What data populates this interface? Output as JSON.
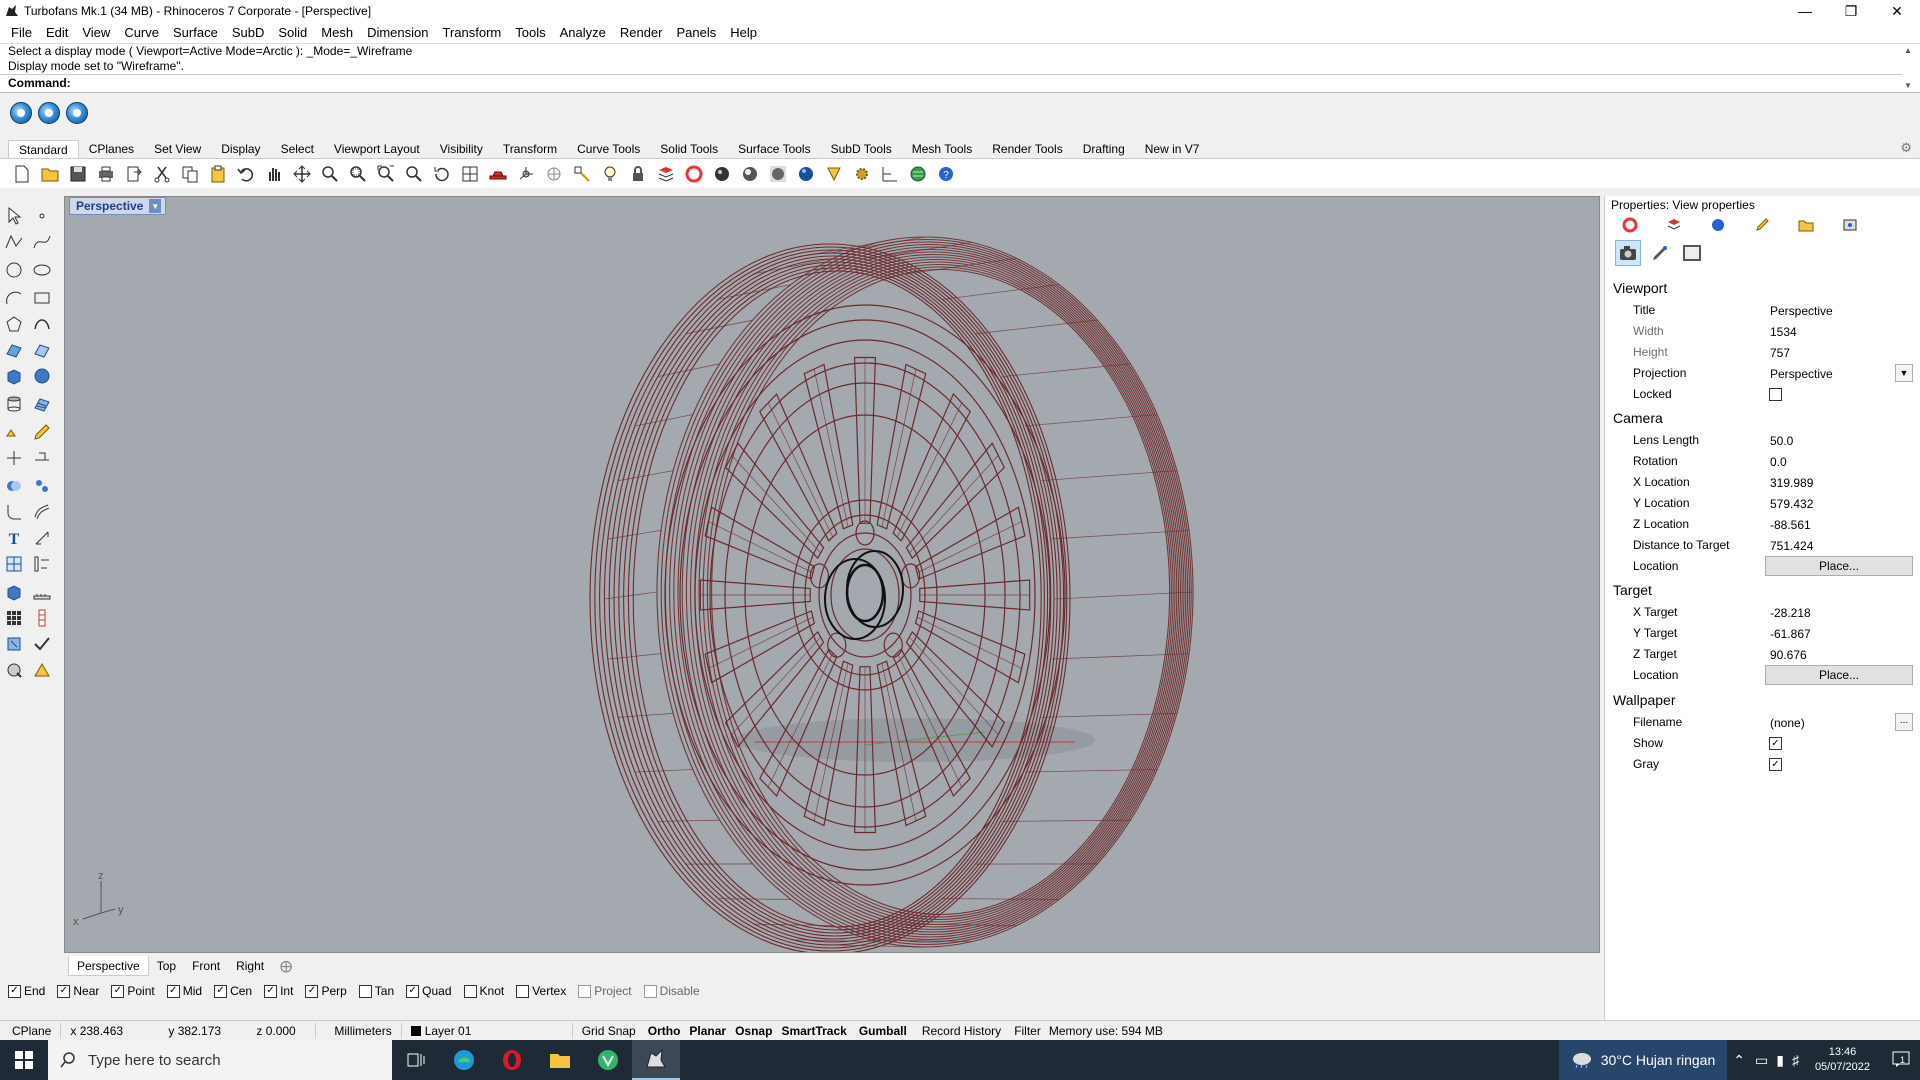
{
  "window": {
    "title": "Turbofans Mk.1 (34 MB) - Rhinoceros 7 Corporate - [Perspective]",
    "controls": [
      "minimize",
      "restore",
      "close"
    ]
  },
  "menu": [
    "File",
    "Edit",
    "View",
    "Curve",
    "Surface",
    "SubD",
    "Solid",
    "Mesh",
    "Dimension",
    "Transform",
    "Tools",
    "Analyze",
    "Render",
    "Panels",
    "Help"
  ],
  "command": {
    "history": [
      "Select a display mode ( Viewport=Active  Mode=Arctic ): _Mode=_Wireframe",
      "Display mode set to \"Wireframe\"."
    ],
    "prompt": "Command:"
  },
  "toolbar_tabs": [
    "Standard",
    "CPlanes",
    "Set View",
    "Display",
    "Select",
    "Viewport Layout",
    "Visibility",
    "Transform",
    "Curve Tools",
    "Solid Tools",
    "Surface Tools",
    "SubD Tools",
    "Mesh Tools",
    "Render Tools",
    "Drafting",
    "New in V7"
  ],
  "active_toolbar_tab": "Standard",
  "viewport": {
    "title": "Perspective",
    "display_mode": "Wireframe",
    "axes": {
      "x": "x",
      "y": "y",
      "z": "z"
    },
    "wire_color": "#6b2a2a",
    "background": "#a4a9b0"
  },
  "viewport_tabs": [
    "Perspective",
    "Top",
    "Front",
    "Right"
  ],
  "osnaps": [
    {
      "label": "End",
      "checked": true,
      "enabled": true
    },
    {
      "label": "Near",
      "checked": true,
      "enabled": true
    },
    {
      "label": "Point",
      "checked": true,
      "enabled": true
    },
    {
      "label": "Mid",
      "checked": true,
      "enabled": true
    },
    {
      "label": "Cen",
      "checked": true,
      "enabled": true
    },
    {
      "label": "Int",
      "checked": true,
      "enabled": true
    },
    {
      "label": "Perp",
      "checked": true,
      "enabled": true
    },
    {
      "label": "Tan",
      "checked": false,
      "enabled": true
    },
    {
      "label": "Quad",
      "checked": true,
      "enabled": true
    },
    {
      "label": "Knot",
      "checked": false,
      "enabled": true
    },
    {
      "label": "Vertex",
      "checked": false,
      "enabled": true
    },
    {
      "label": "Project",
      "checked": false,
      "enabled": false
    },
    {
      "label": "Disable",
      "checked": false,
      "enabled": false
    }
  ],
  "status": {
    "cplane": "CPlane",
    "x": "x 238.463",
    "y": "y 382.173",
    "z": "z 0.000",
    "units": "Millimeters",
    "layer": "Layer 01",
    "grid_snap": "Grid Snap",
    "ortho": "Ortho",
    "planar": "Planar",
    "osnap": "Osnap",
    "smarttrack": "SmartTrack",
    "gumball": "Gumball",
    "record_history": "Record History",
    "filter": "Filter",
    "memory": "Memory use: 594 MB"
  },
  "properties": {
    "header": "Properties: View properties",
    "sections": {
      "viewport": "Viewport",
      "camera": "Camera",
      "target": "Target",
      "wallpaper": "Wallpaper"
    },
    "viewport": {
      "title_label": "Title",
      "title": "Perspective",
      "width_label": "Width",
      "width": "1534",
      "height_label": "Height",
      "height": "757",
      "projection_label": "Projection",
      "projection": "Perspective",
      "locked_label": "Locked",
      "locked": false
    },
    "camera": {
      "lens_label": "Lens Length",
      "lens": "50.0",
      "rotation_label": "Rotation",
      "rotation": "0.0",
      "x_label": "X Location",
      "x": "319.989",
      "y_label": "Y Location",
      "y": "579.432",
      "z_label": "Z Location",
      "z": "-88.561",
      "dist_label": "Distance to Target",
      "dist": "751.424",
      "location_label": "Location",
      "place": "Place..."
    },
    "target": {
      "x_label": "X Target",
      "x": "-28.218",
      "y_label": "Y Target",
      "y": "-61.867",
      "z_label": "Z Target",
      "z": "90.676",
      "location_label": "Location",
      "place": "Place..."
    },
    "wallpaper": {
      "filename_label": "Filename",
      "filename": "(none)",
      "show_label": "Show",
      "show": true,
      "gray_label": "Gray",
      "gray": true,
      "browse": "..."
    }
  },
  "taskbar": {
    "search_placeholder": "Type here to search",
    "weather": "30°C  Hujan ringan",
    "time": "13:46",
    "date": "05/07/2022",
    "notifications": "1"
  }
}
